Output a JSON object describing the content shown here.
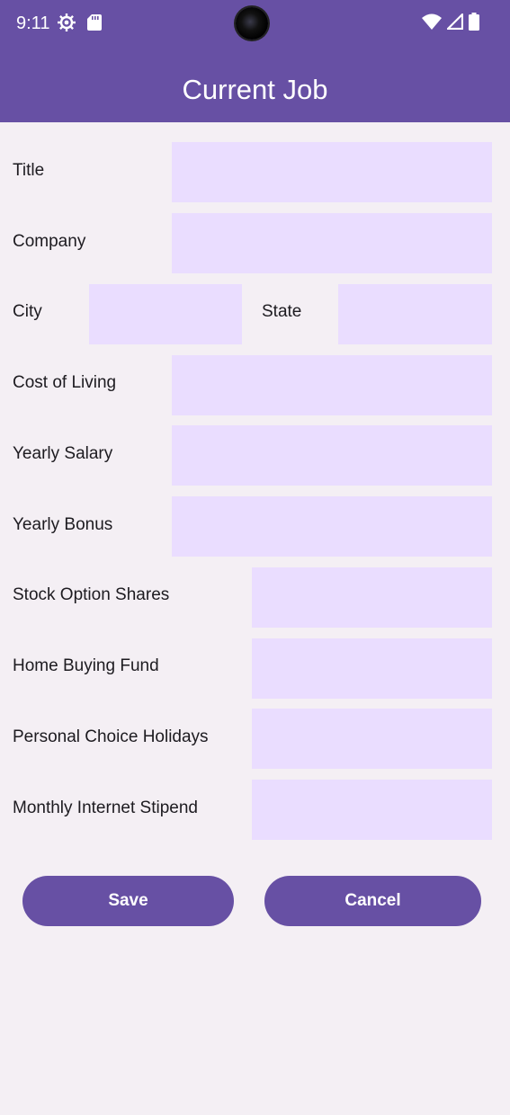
{
  "status_bar": {
    "time": "9:11",
    "icons_left": [
      "settings-icon",
      "sd-card-icon"
    ],
    "icons_right": [
      "wifi-icon",
      "signal-icon",
      "battery-icon"
    ]
  },
  "app_bar": {
    "title": "Current Job",
    "color": "#6750a4"
  },
  "form": {
    "field_color": "#eaddff",
    "title": {
      "label": "Title",
      "value": ""
    },
    "company": {
      "label": "Company",
      "value": ""
    },
    "city": {
      "label": "City",
      "value": ""
    },
    "state": {
      "label": "State",
      "value": ""
    },
    "cost_of_living": {
      "label": "Cost of Living",
      "value": ""
    },
    "yearly_salary": {
      "label": "Yearly Salary",
      "value": ""
    },
    "yearly_bonus": {
      "label": "Yearly Bonus",
      "value": ""
    },
    "stock_option_shares": {
      "label": "Stock Option Shares",
      "value": ""
    },
    "home_buying_fund": {
      "label": "Home Buying Fund",
      "value": ""
    },
    "personal_choice_holidays": {
      "label": "Personal Choice Holidays",
      "value": ""
    },
    "monthly_internet_stipend": {
      "label": "Monthly Internet Stipend",
      "value": ""
    }
  },
  "actions": {
    "save_label": "Save",
    "cancel_label": "Cancel"
  }
}
